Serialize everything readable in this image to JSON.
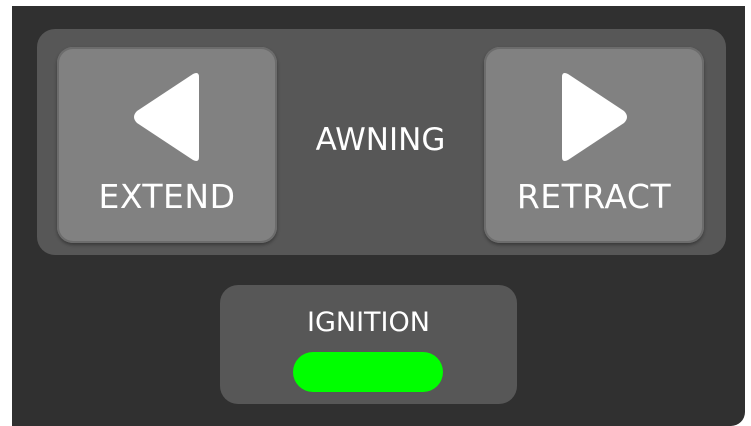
{
  "awning": {
    "title": "AWNING",
    "extend_label": "EXTEND",
    "retract_label": "RETRACT",
    "extend_icon": "arrow-left-icon",
    "retract_icon": "arrow-right-icon"
  },
  "ignition": {
    "label": "IGNITION",
    "indicator_state": "on",
    "indicator_color": "#00ff00"
  },
  "colors": {
    "background": "#303030",
    "panel": "#575757",
    "button": "#818181",
    "text": "#ffffff"
  }
}
